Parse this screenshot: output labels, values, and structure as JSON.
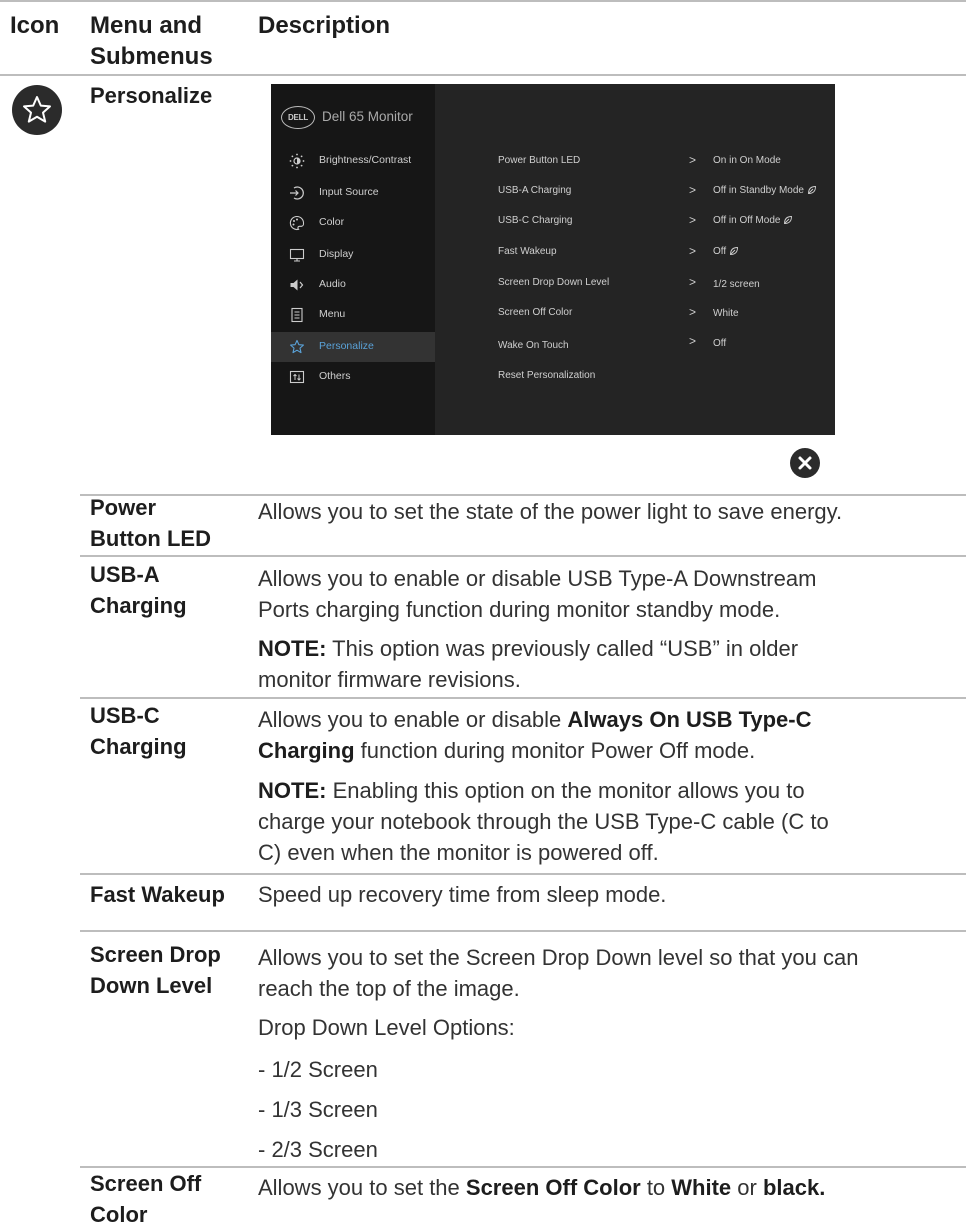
{
  "header": {
    "icon": "Icon",
    "menu_line1": "Menu and",
    "menu_line2": "Submenus",
    "description": "Description"
  },
  "section": {
    "label": "Personalize",
    "icon": "star-icon"
  },
  "osd": {
    "brand": "DELL",
    "title": "Dell 65 Monitor",
    "menu": [
      {
        "label": "Brightness/Contrast",
        "icon": "brightness-icon"
      },
      {
        "label": "Input Source",
        "icon": "input-source-icon"
      },
      {
        "label": "Color",
        "icon": "color-palette-icon"
      },
      {
        "label": "Display",
        "icon": "display-icon"
      },
      {
        "label": "Audio",
        "icon": "speaker-icon"
      },
      {
        "label": "Menu",
        "icon": "menu-icon"
      },
      {
        "label": "Personalize",
        "icon": "star-icon"
      },
      {
        "label": "Others",
        "icon": "others-icon"
      }
    ],
    "active_index": 6,
    "accent": "#5aa2d8",
    "submenu": [
      {
        "label": "Power Button LED",
        "value": "On in On Mode"
      },
      {
        "label": "USB-A Charging",
        "value": "Off in Standby Mode"
      },
      {
        "label": "USB-C Charging",
        "value": "Off in Off Mode"
      },
      {
        "label": "Fast Wakeup",
        "value": "Off"
      },
      {
        "label": "Screen Drop Down Level",
        "value": "1/2 screen"
      },
      {
        "label": "Screen Off Color",
        "value": "White"
      },
      {
        "label": "Wake On Touch",
        "value": "Off"
      },
      {
        "label": "Reset Personalization",
        "value": ""
      }
    ],
    "close_icon": "close-icon"
  },
  "rows": {
    "power_led": {
      "label1": "Power",
      "label2": "Button LED",
      "desc": "Allows you to set the state of the power light to save energy."
    },
    "usba": {
      "label1": "USB-A",
      "label2": "Charging",
      "desc1": "Allows you to enable or disable USB Type-A Downstream",
      "desc2": "Ports charging function during monitor standby mode.",
      "note_label": "NOTE:",
      "note1": " This option was previously called “USB” in older",
      "note2": "monitor firmware revisions."
    },
    "usbc": {
      "label1": "USB-C",
      "label2": "Charging",
      "desc_pre": "Allows you to enable or disable ",
      "desc_bold1": "Always On USB Type-C",
      "desc_bold2": "Charging",
      "desc_post": " function during monitor Power Off mode.",
      "note_label": "NOTE:",
      "note1": " Enabling this option on the monitor allows you to",
      "note2": "charge your notebook through the USB Type-C cable (C to",
      "note3": "C) even when the monitor is powered off."
    },
    "fast_wakeup": {
      "label": "Fast Wakeup",
      "desc": "Speed up recovery time from sleep mode."
    },
    "drop_down": {
      "label1": "Screen Drop",
      "label2": "Down Level",
      "desc1": "Allows you to set the Screen Drop Down level so that you can",
      "desc2": "reach the top of the image.",
      "options_title": "Drop Down Level Options:",
      "options": [
        "- 1/2 Screen",
        "- 1/3 Screen",
        "- 2/3 Screen"
      ]
    },
    "screen_off": {
      "label1": "Screen Off",
      "label2": "Color",
      "desc_pre": "Allows you to set the ",
      "desc_b1": "Screen Off Color",
      "desc_mid": " to ",
      "desc_b2": "White",
      "desc_or": " or ",
      "desc_b3": "black."
    }
  }
}
